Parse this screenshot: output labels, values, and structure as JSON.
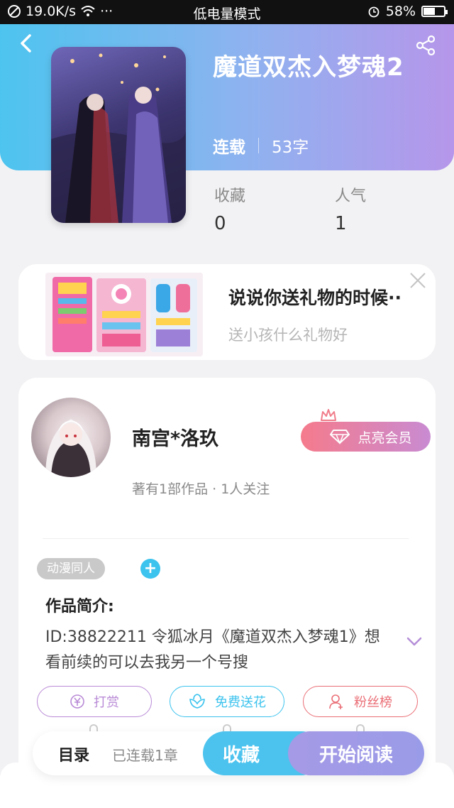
{
  "status_bar": {
    "speed": "19.0K/s",
    "dots": "···",
    "mode": "低电量模式",
    "battery": "58%",
    "battery_level": 0.58
  },
  "book": {
    "title": "魔道双杰入梦魂2",
    "status": "连载",
    "word_count": "53字",
    "stats": [
      {
        "label": "收藏",
        "value": "0"
      },
      {
        "label": "人气",
        "value": "1"
      }
    ]
  },
  "ad": {
    "title": "说说你送礼物的时候··",
    "subtitle": "送小孩什么礼物好"
  },
  "author": {
    "name": "南宫*洛玖",
    "stats": "著有1部作品 · 1人关注",
    "vip_label": "点亮会员"
  },
  "tags": [
    "动漫同人"
  ],
  "intro": {
    "heading": "作品简介:",
    "text": "ID:38822211 令狐冰月《魔道双杰入梦魂1》想看前续的可以去我另一个号搜"
  },
  "actions": [
    {
      "label": "打赏",
      "color": "#b98ad6"
    },
    {
      "label": "免费送花",
      "color": "#3cc3ee"
    },
    {
      "label": "粉丝榜",
      "color": "#ea6e76"
    }
  ],
  "bottom": {
    "toc_label": "目录",
    "chapters": "已连载1章",
    "favorite_label": "收藏",
    "read_label": "开始阅读"
  }
}
